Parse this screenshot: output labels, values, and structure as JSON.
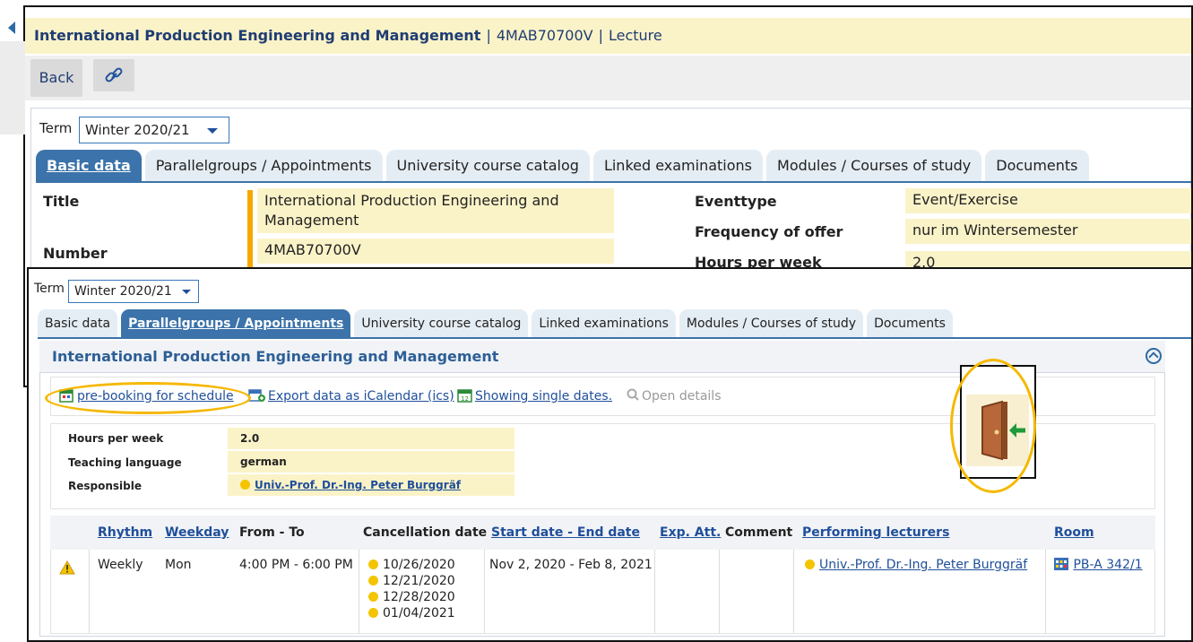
{
  "back": {
    "header": {
      "title": "International Production Engineering and Management",
      "number": "4MAB70700V",
      "type": "Lecture",
      "separator": "|"
    },
    "toolbar": {
      "back_label": "Back"
    },
    "term": {
      "label": "Term",
      "value": "Winter 2020/21"
    },
    "tabs": [
      "Basic data",
      "Parallelgroups / Appointments",
      "University course catalog",
      "Linked examinations",
      "Modules / Courses of study",
      "Documents"
    ],
    "fields": {
      "title_label": "Title",
      "title_value_1": "International Production Engineering and",
      "title_value_2": "Management",
      "number_label": "Number",
      "number_value": "4MAB70700V",
      "eventtype_label": "Eventtype",
      "eventtype_value": "Event/Exercise",
      "frequency_label": "Frequency of offer",
      "frequency_value": "nur im Wintersemester",
      "hours_label": "Hours per week",
      "hours_value": "2.0"
    }
  },
  "front": {
    "term": {
      "label": "Term",
      "value": "Winter 2020/21"
    },
    "tabs": [
      "Basic data",
      "Parallelgroups / Appointments",
      "University course catalog",
      "Linked examinations",
      "Modules / Courses of study",
      "Documents"
    ],
    "section_title": "International Production Engineering and Management",
    "actions": {
      "prebooking": "pre-booking for schedule",
      "export": "Export data as iCalendar (ics)",
      "single_dates": "Showing single dates.",
      "open_details": "Open details"
    },
    "info": {
      "hours_label": "Hours per week",
      "hours_value": "2.0",
      "language_label": "Teaching language",
      "language_value": "german",
      "responsible_label": "Responsible",
      "responsible_value": "Univ.-Prof. Dr.-Ing. Peter Burggräf"
    },
    "table": {
      "headers": {
        "rhythm": "Rhythm",
        "weekday": "Weekday",
        "from_to": "From - To",
        "cancellation": "Cancellation date",
        "start_end": "Start date - End date",
        "exp_att": "Exp. Att.",
        "comment": "Comment",
        "lecturers": "Performing lecturers",
        "room": "Room"
      },
      "row": {
        "rhythm": "Weekly",
        "weekday": "Mon",
        "from_to": "4:00 PM - 6:00 PM",
        "cancellations": [
          "10/26/2020",
          "12/21/2020",
          "12/28/2020",
          "01/04/2021"
        ],
        "start_end": "Nov 2, 2020 - Feb 8, 2021",
        "lecturer": "Univ.-Prof. Dr.-Ing. Peter Burggräf",
        "room": "PB-A 342/1"
      }
    }
  },
  "colors": {
    "accent": "#3b73aa",
    "highlight": "#fbf3c8",
    "annotation": "#f7a800",
    "link": "#1f4f9a"
  }
}
